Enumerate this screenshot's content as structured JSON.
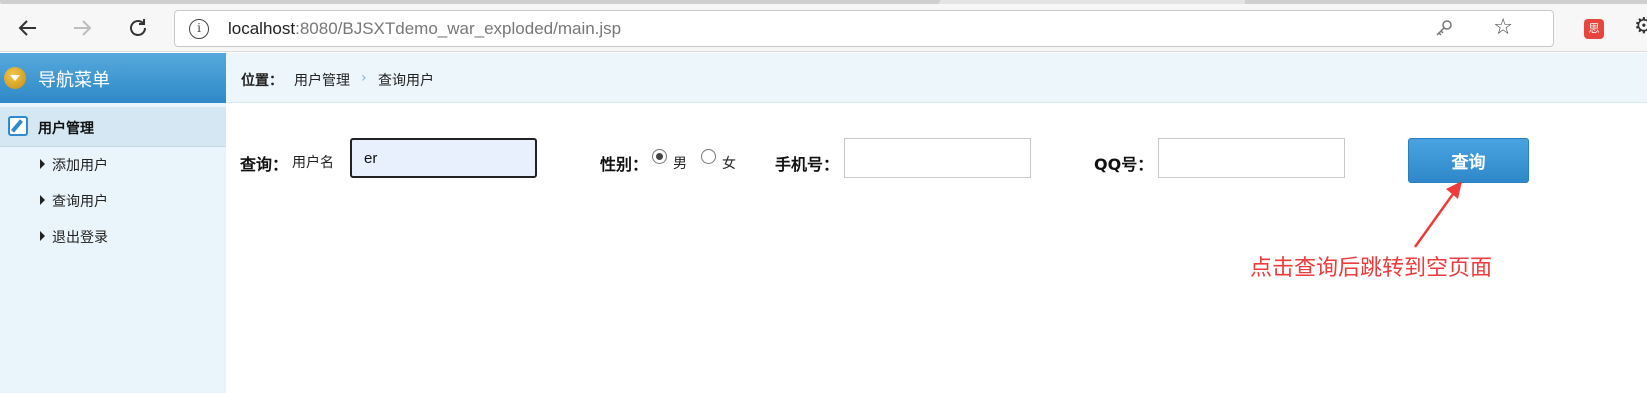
{
  "browser": {
    "back_icon": "arrow-left-icon",
    "forward_icon": "arrow-right-icon",
    "reload_icon": "reload-icon",
    "url_host": "localhost",
    "url_rest": ":8080/BJSXTdemo_war_exploded/main.jsp",
    "extension_badge": "思"
  },
  "sidebar": {
    "title": "导航菜单",
    "group_label": "用户管理",
    "items": [
      {
        "label": "添加用户"
      },
      {
        "label": "查询用户"
      },
      {
        "label": "退出登录"
      }
    ]
  },
  "breadcrumb": {
    "prefix": "位置：",
    "crumbs": [
      "用户管理",
      "查询用户"
    ],
    "separator": "›"
  },
  "search_form": {
    "query_label": "查询：",
    "username_label": "用户名",
    "username_value": "er",
    "gender_label": "性别：",
    "gender_options": [
      "男",
      "女"
    ],
    "gender_selected": "男",
    "phone_label": "手机号：",
    "phone_value": "",
    "qq_label": "QQ号：",
    "qq_value": "",
    "submit_label": "查询"
  },
  "annotation": {
    "text": "点击查询后跳转到空页面",
    "color": "#ee3b3b"
  }
}
